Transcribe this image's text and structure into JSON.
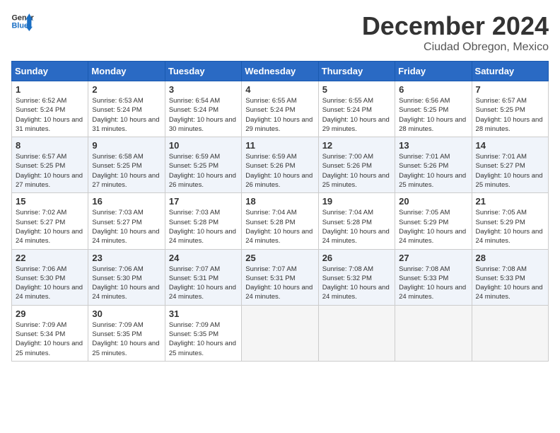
{
  "header": {
    "logo_line1": "General",
    "logo_line2": "Blue",
    "month": "December 2024",
    "location": "Ciudad Obregon, Mexico"
  },
  "weekdays": [
    "Sunday",
    "Monday",
    "Tuesday",
    "Wednesday",
    "Thursday",
    "Friday",
    "Saturday"
  ],
  "weeks": [
    [
      {
        "day": "1",
        "sunrise": "6:52 AM",
        "sunset": "5:24 PM",
        "daylight": "10 hours and 31 minutes."
      },
      {
        "day": "2",
        "sunrise": "6:53 AM",
        "sunset": "5:24 PM",
        "daylight": "10 hours and 31 minutes."
      },
      {
        "day": "3",
        "sunrise": "6:54 AM",
        "sunset": "5:24 PM",
        "daylight": "10 hours and 30 minutes."
      },
      {
        "day": "4",
        "sunrise": "6:55 AM",
        "sunset": "5:24 PM",
        "daylight": "10 hours and 29 minutes."
      },
      {
        "day": "5",
        "sunrise": "6:55 AM",
        "sunset": "5:24 PM",
        "daylight": "10 hours and 29 minutes."
      },
      {
        "day": "6",
        "sunrise": "6:56 AM",
        "sunset": "5:25 PM",
        "daylight": "10 hours and 28 minutes."
      },
      {
        "day": "7",
        "sunrise": "6:57 AM",
        "sunset": "5:25 PM",
        "daylight": "10 hours and 28 minutes."
      }
    ],
    [
      {
        "day": "8",
        "sunrise": "6:57 AM",
        "sunset": "5:25 PM",
        "daylight": "10 hours and 27 minutes."
      },
      {
        "day": "9",
        "sunrise": "6:58 AM",
        "sunset": "5:25 PM",
        "daylight": "10 hours and 27 minutes."
      },
      {
        "day": "10",
        "sunrise": "6:59 AM",
        "sunset": "5:25 PM",
        "daylight": "10 hours and 26 minutes."
      },
      {
        "day": "11",
        "sunrise": "6:59 AM",
        "sunset": "5:26 PM",
        "daylight": "10 hours and 26 minutes."
      },
      {
        "day": "12",
        "sunrise": "7:00 AM",
        "sunset": "5:26 PM",
        "daylight": "10 hours and 25 minutes."
      },
      {
        "day": "13",
        "sunrise": "7:01 AM",
        "sunset": "5:26 PM",
        "daylight": "10 hours and 25 minutes."
      },
      {
        "day": "14",
        "sunrise": "7:01 AM",
        "sunset": "5:27 PM",
        "daylight": "10 hours and 25 minutes."
      }
    ],
    [
      {
        "day": "15",
        "sunrise": "7:02 AM",
        "sunset": "5:27 PM",
        "daylight": "10 hours and 24 minutes."
      },
      {
        "day": "16",
        "sunrise": "7:03 AM",
        "sunset": "5:27 PM",
        "daylight": "10 hours and 24 minutes."
      },
      {
        "day": "17",
        "sunrise": "7:03 AM",
        "sunset": "5:28 PM",
        "daylight": "10 hours and 24 minutes."
      },
      {
        "day": "18",
        "sunrise": "7:04 AM",
        "sunset": "5:28 PM",
        "daylight": "10 hours and 24 minutes."
      },
      {
        "day": "19",
        "sunrise": "7:04 AM",
        "sunset": "5:28 PM",
        "daylight": "10 hours and 24 minutes."
      },
      {
        "day": "20",
        "sunrise": "7:05 AM",
        "sunset": "5:29 PM",
        "daylight": "10 hours and 24 minutes."
      },
      {
        "day": "21",
        "sunrise": "7:05 AM",
        "sunset": "5:29 PM",
        "daylight": "10 hours and 24 minutes."
      }
    ],
    [
      {
        "day": "22",
        "sunrise": "7:06 AM",
        "sunset": "5:30 PM",
        "daylight": "10 hours and 24 minutes."
      },
      {
        "day": "23",
        "sunrise": "7:06 AM",
        "sunset": "5:30 PM",
        "daylight": "10 hours and 24 minutes."
      },
      {
        "day": "24",
        "sunrise": "7:07 AM",
        "sunset": "5:31 PM",
        "daylight": "10 hours and 24 minutes."
      },
      {
        "day": "25",
        "sunrise": "7:07 AM",
        "sunset": "5:31 PM",
        "daylight": "10 hours and 24 minutes."
      },
      {
        "day": "26",
        "sunrise": "7:08 AM",
        "sunset": "5:32 PM",
        "daylight": "10 hours and 24 minutes."
      },
      {
        "day": "27",
        "sunrise": "7:08 AM",
        "sunset": "5:33 PM",
        "daylight": "10 hours and 24 minutes."
      },
      {
        "day": "28",
        "sunrise": "7:08 AM",
        "sunset": "5:33 PM",
        "daylight": "10 hours and 24 minutes."
      }
    ],
    [
      {
        "day": "29",
        "sunrise": "7:09 AM",
        "sunset": "5:34 PM",
        "daylight": "10 hours and 25 minutes."
      },
      {
        "day": "30",
        "sunrise": "7:09 AM",
        "sunset": "5:35 PM",
        "daylight": "10 hours and 25 minutes."
      },
      {
        "day": "31",
        "sunrise": "7:09 AM",
        "sunset": "5:35 PM",
        "daylight": "10 hours and 25 minutes."
      },
      null,
      null,
      null,
      null
    ]
  ]
}
